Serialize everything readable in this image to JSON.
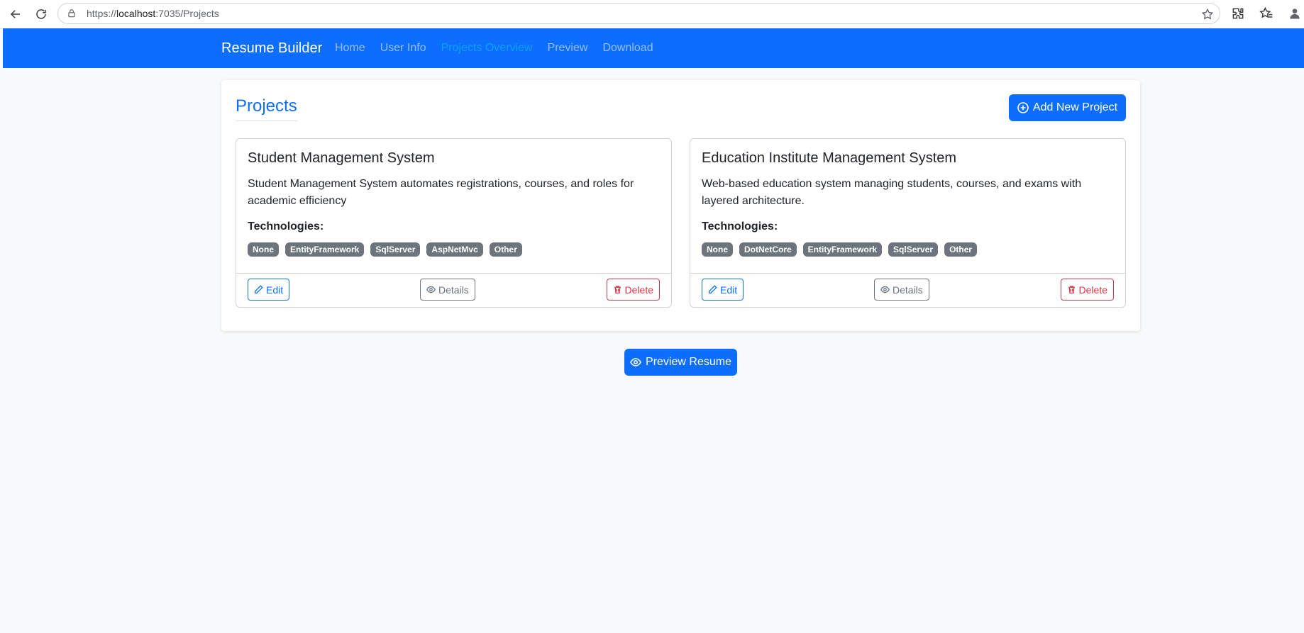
{
  "browser": {
    "url_prefix": "https://",
    "url_host": "localhost",
    "url_rest": ":7035/Projects"
  },
  "navbar": {
    "brand": "Resume Builder",
    "links": [
      {
        "label": "Home"
      },
      {
        "label": "User Info"
      },
      {
        "label": "Projects Overview"
      },
      {
        "label": "Preview"
      },
      {
        "label": "Download"
      }
    ]
  },
  "page": {
    "title": "Projects",
    "add_button": "Add New Project",
    "preview_button": "Preview Resume"
  },
  "projects": [
    {
      "title": "Student Management System",
      "description": "Student Management System automates registrations, courses, and roles for academic efficiency",
      "tech_label": "Technologies:",
      "technologies": [
        "None",
        "EntityFramework",
        "SqlServer",
        "AspNetMvc",
        "Other"
      ],
      "edit": "Edit",
      "details": "Details",
      "delete": "Delete"
    },
    {
      "title": "Education Institute Management System",
      "description": "Web-based education system managing students, courses, and exams with layered architecture.",
      "tech_label": "Technologies:",
      "technologies": [
        "None",
        "DotNetCore",
        "EntityFramework",
        "SqlServer",
        "Other"
      ],
      "edit": "Edit",
      "details": "Details",
      "delete": "Delete"
    }
  ],
  "colors": {
    "primary": "#0d6efd",
    "secondary": "#6c757d",
    "danger": "#dc3545",
    "background": "#f8f9fa"
  }
}
